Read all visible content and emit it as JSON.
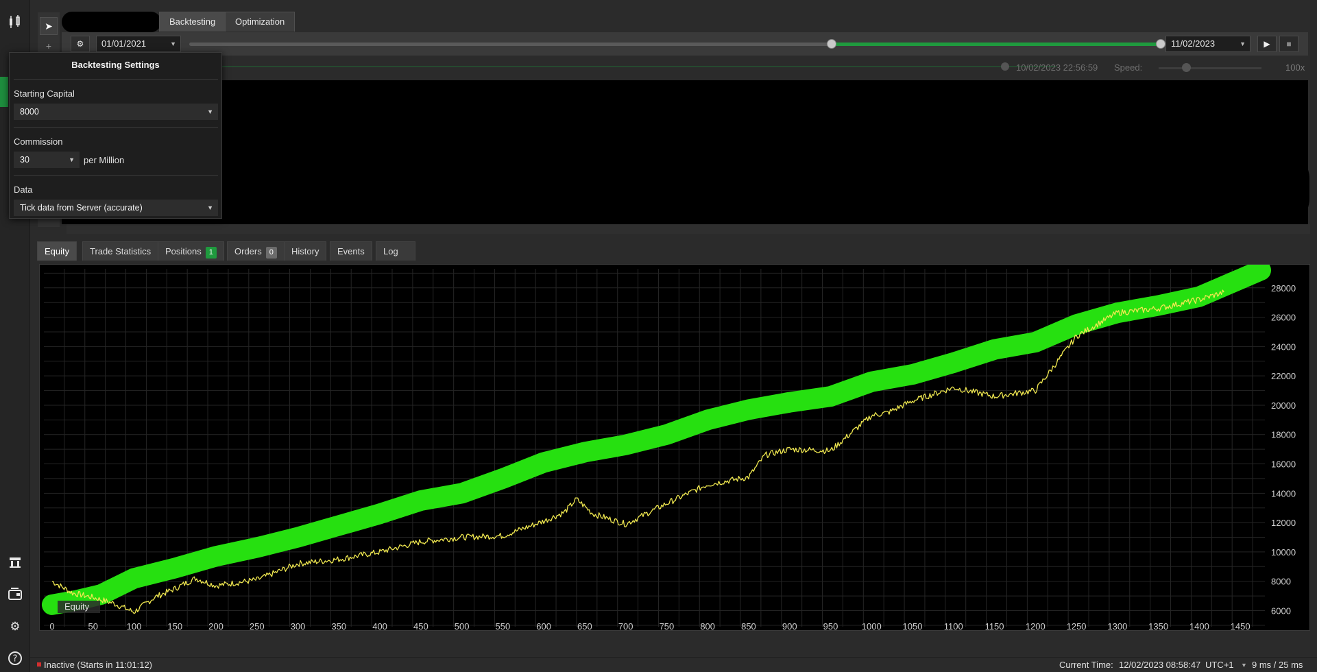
{
  "top_tabs": [
    {
      "label": "Backtesting"
    },
    {
      "label": "Optimization"
    }
  ],
  "toolbar": {
    "start_date": "01/01/2021",
    "end_date": "11/02/2023"
  },
  "replay": {
    "timestamp": "10/02/2023 22:56:59",
    "speed_label": "Speed:",
    "speed_value": "100x"
  },
  "settings": {
    "title": "Backtesting Settings",
    "capital_label": "Starting Capital",
    "capital_value": "8000",
    "commission_label": "Commission",
    "commission_value": "30",
    "commission_unit": "per Million",
    "data_label": "Data",
    "data_value": "Tick data from Server (accurate)"
  },
  "bottom_tabs": [
    {
      "label": "Equity"
    },
    {
      "label": "Trade Statistics"
    },
    {
      "label": "Positions",
      "badge": "1"
    },
    {
      "label": "Orders",
      "badge": "0"
    },
    {
      "label": "History"
    },
    {
      "label": "Events"
    },
    {
      "label": "Log"
    }
  ],
  "colors": {
    "accent_green": "#1f9a3e",
    "badge_green": "#1f9a3e",
    "badge_gray": "#6b6b6b",
    "balance_line": "#26e010",
    "equity_line": "#f0e850",
    "grid": "#252525"
  },
  "status": {
    "state": "Inactive (Starts in 11:01:12)",
    "current_time_label": "Current Time:",
    "current_time": "12/02/2023 08:58:47",
    "timezone": "UTC+1",
    "latency": "9 ms / 25 ms"
  },
  "chart_data": {
    "type": "line",
    "title": "",
    "xlabel": "",
    "ylabel": "",
    "xlim": [
      -10,
      1480
    ],
    "ylim": [
      4900,
      29300
    ],
    "x_ticks": [
      0,
      50,
      100,
      150,
      200,
      250,
      300,
      350,
      400,
      450,
      500,
      550,
      600,
      650,
      700,
      750,
      800,
      850,
      900,
      950,
      1000,
      1050,
      1100,
      1150,
      1200,
      1250,
      1300,
      1350,
      1400,
      1450
    ],
    "y_ticks": [
      6000,
      8000,
      10000,
      12000,
      14000,
      16000,
      18000,
      20000,
      22000,
      24000,
      26000,
      28000
    ],
    "legend_visible": "Equity",
    "series": [
      {
        "name": "Equity",
        "color": "#f0e850",
        "x": [
          0,
          25,
          50,
          75,
          100,
          125,
          150,
          175,
          200,
          250,
          300,
          350,
          400,
          450,
          500,
          550,
          600,
          625,
          640,
          660,
          700,
          750,
          800,
          850,
          870,
          900,
          950,
          1000,
          1020,
          1050,
          1100,
          1150,
          1200,
          1250,
          1300,
          1350,
          1400,
          1430
        ],
        "y": [
          8000,
          7200,
          6900,
          6500,
          5900,
          6900,
          7500,
          8200,
          7700,
          8100,
          9200,
          9500,
          10000,
          10700,
          11000,
          11100,
          12100,
          12700,
          13600,
          12600,
          11900,
          13300,
          14600,
          15100,
          16600,
          17000,
          16900,
          19300,
          19500,
          20300,
          21200,
          20600,
          21000,
          24700,
          26300,
          26600,
          27200,
          27700
        ]
      },
      {
        "name": "",
        "color": "#26e010",
        "x": [
          0,
          30,
          60,
          100,
          150,
          200,
          250,
          300,
          350,
          400,
          450,
          500,
          550,
          600,
          650,
          700,
          750,
          800,
          850,
          900,
          950,
          1000,
          1050,
          1100,
          1150,
          1200,
          1250,
          1300,
          1350,
          1400,
          1450,
          1475
        ],
        "y": [
          6400,
          6700,
          7100,
          8200,
          8900,
          9700,
          10300,
          11000,
          11800,
          12600,
          13500,
          14000,
          15000,
          16100,
          16800,
          17300,
          18000,
          19000,
          19700,
          20200,
          20600,
          21600,
          22100,
          22900,
          23800,
          24300,
          25500,
          26300,
          26800,
          27400,
          28600,
          29200
        ]
      }
    ]
  }
}
